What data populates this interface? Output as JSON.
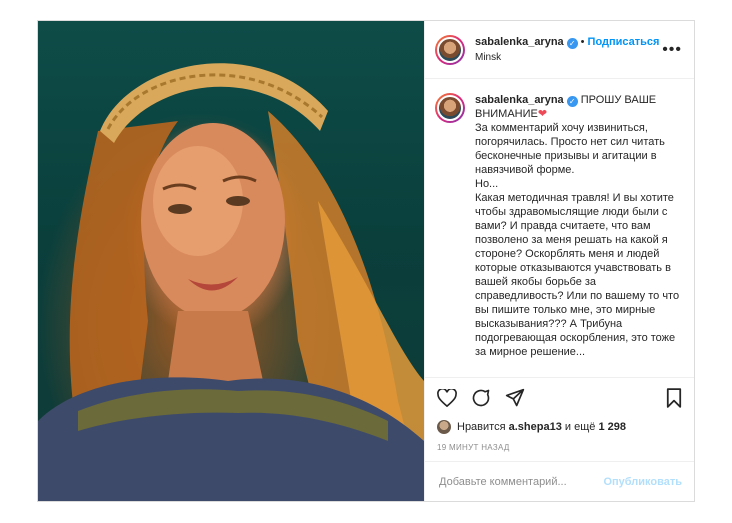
{
  "post": {
    "username": "sabalenka_aryna",
    "follow_label": "Подписаться",
    "separator": "•",
    "location": "Minsk",
    "more_label": "•••",
    "caption_title": "ПРОШУ ВАШЕ ВНИМАНИЕ",
    "caption_heart": "❤",
    "caption_text": "За комментарий хочу извиниться, погорячилась. Просто нет сил читать бесконечные призывы и агитации в навязчивой форме.\nНо...\nКакая методичная травля! И вы хотите чтобы здравомыслящие люди были с вами? И правда считаете, что вам позволено за меня решать на какой я стороне? Оскорблять меня и людей которые отказываются учавствовать в вашей якобы борьбе за справедливость? Или по вашему то что вы пишите только мне, это мирные высказывания??? А Трибуна подогревающая оскорбления, это тоже за мирное решение...",
    "likes_prefix": "Нравится",
    "likes_user": "a.shepa13",
    "likes_middle": "и ещё",
    "likes_count": "1 298",
    "timestamp": "19 МИНУТ НАЗАД",
    "comment_placeholder": "Добавьте комментарий...",
    "publish_label": "Опубликовать"
  },
  "icons": {
    "like": "heart-icon",
    "comment": "comment-icon",
    "share": "share-icon",
    "save": "bookmark-icon",
    "verified": "verified-badge-icon",
    "more": "more-options-icon"
  },
  "colors": {
    "accent": "#0095f6",
    "verified": "#3897f0",
    "heart": "#ed4956",
    "muted": "#8e8e8e"
  }
}
